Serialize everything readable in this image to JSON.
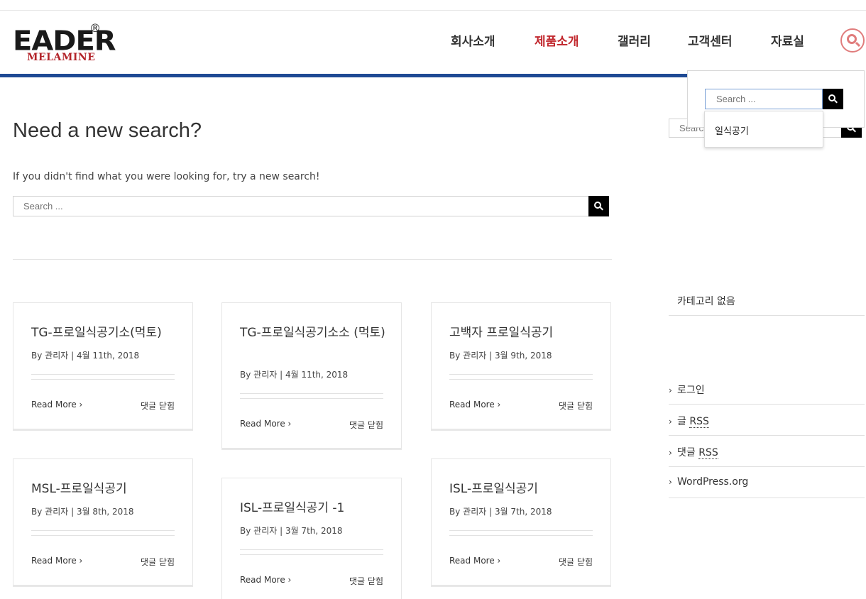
{
  "header": {
    "logo_main": "EADER",
    "logo_reg": "®",
    "logo_sub": "MELAMINE",
    "nav": [
      "회사소개",
      "제품소개",
      "갤러리",
      "고객센터",
      "자료실"
    ],
    "active_nav": "제품소개",
    "accent_color": "#c1272d",
    "bar_color": "#1f4a94",
    "search_icon": "search-icon"
  },
  "popup_search": {
    "placeholder": "Search ...",
    "suggestion": "일식공기"
  },
  "main": {
    "heading": "Need a new search?",
    "subtext": "If you didn't find what you were looking for, try a new search!",
    "search_placeholder": "Search ..."
  },
  "posts": [
    {
      "title": "TG-프로일식공기소(먹토)",
      "meta": "By 관리자  |   4월 11th, 2018",
      "read_more": "Read More",
      "comments": "댓글 닫힘"
    },
    {
      "title": "TG-프로일식공기소소 (먹토)",
      "meta": "By 관리자  |   4월 11th, 2018",
      "read_more": "Read More",
      "comments": "댓글 닫힘"
    },
    {
      "title": "고백자 프로일식공기",
      "meta": "By 관리자  |   3월 9th, 2018",
      "read_more": "Read More",
      "comments": "댓글 닫힘"
    },
    {
      "title": "MSL-프로일식공기",
      "meta": "By 관리자  |   3월 8th, 2018",
      "read_more": "Read More",
      "comments": "댓글 닫힘"
    },
    {
      "title": "ISL-프로일식공기        -1",
      "meta": "By 관리자  |   3월 7th, 2018",
      "read_more": "Read More",
      "comments": "댓글 닫힘"
    },
    {
      "title": "ISL-프로일식공기",
      "meta": "By 관리자  |   3월 7th, 2018",
      "read_more": "Read More",
      "comments": "댓글 닫힘"
    }
  ],
  "sidebar": {
    "search_placeholder": "Search ...",
    "categories_empty": "카테고리 없음",
    "meta_links": [
      {
        "label": "로그인",
        "abbr": ""
      },
      {
        "label": "글 ",
        "abbr": "RSS"
      },
      {
        "label": "댓글 ",
        "abbr": "RSS"
      },
      {
        "label": "WordPress.org",
        "abbr": ""
      }
    ]
  }
}
